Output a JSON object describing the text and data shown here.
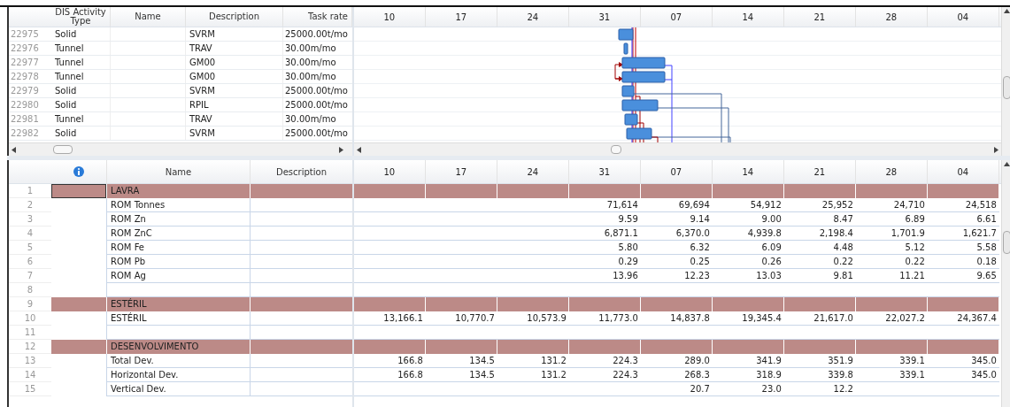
{
  "top_grid": {
    "columns": [
      "DIS Activity Type",
      "Name",
      "Description",
      "Task rate"
    ],
    "rows": [
      {
        "id": "22975",
        "type": "Solid",
        "description": "SVRM",
        "task_rate": "25000.00t/mo"
      },
      {
        "id": "22976",
        "type": "Tunnel",
        "description": "TRAV",
        "task_rate": "30.00m/mo"
      },
      {
        "id": "22977",
        "type": "Tunnel",
        "description": "GM00",
        "task_rate": "30.00m/mo"
      },
      {
        "id": "22978",
        "type": "Tunnel",
        "description": "GM00",
        "task_rate": "30.00m/mo"
      },
      {
        "id": "22979",
        "type": "Solid",
        "description": "SVRM",
        "task_rate": "25000.00t/mo"
      },
      {
        "id": "22980",
        "type": "Solid",
        "description": "RPIL",
        "task_rate": "25000.00t/mo"
      },
      {
        "id": "22981",
        "type": "Tunnel",
        "description": "TRAV",
        "task_rate": "30.00m/mo"
      },
      {
        "id": "22982",
        "type": "Solid",
        "description": "SVRM",
        "task_rate": "25000.00t/mo"
      }
    ],
    "timeline": [
      "10",
      "17",
      "24",
      "31",
      "07",
      "14",
      "21",
      "28",
      "04"
    ]
  },
  "bottom_grid": {
    "columns": [
      "Name",
      "Description"
    ],
    "timeline": [
      "10",
      "17",
      "24",
      "31",
      "07",
      "14",
      "21",
      "28",
      "04"
    ],
    "rows": [
      {
        "number": "1",
        "kind": "group",
        "name": "LAVRA",
        "selected": true
      },
      {
        "number": "2",
        "kind": "item",
        "name": "ROM Tonnes",
        "values": {
          "c3": "71,614",
          "c4": "69,694",
          "c5": "54,912",
          "c6": "25,952",
          "c7": "24,710",
          "c8": "24,518"
        }
      },
      {
        "number": "3",
        "kind": "item",
        "name": "ROM Zn",
        "values": {
          "c3": "9.59",
          "c4": "9.14",
          "c5": "9.00",
          "c6": "8.47",
          "c7": "6.89",
          "c8": "6.61"
        }
      },
      {
        "number": "4",
        "kind": "item",
        "name": "ROM ZnC",
        "values": {
          "c3": "6,871.1",
          "c4": "6,370.0",
          "c5": "4,939.8",
          "c6": "2,198.4",
          "c7": "1,701.9",
          "c8": "1,621.7"
        }
      },
      {
        "number": "5",
        "kind": "item",
        "name": "ROM Fe",
        "values": {
          "c3": "5.80",
          "c4": "6.32",
          "c5": "6.09",
          "c6": "4.48",
          "c7": "5.12",
          "c8": "5.58"
        }
      },
      {
        "number": "6",
        "kind": "item",
        "name": "ROM Pb",
        "values": {
          "c3": "0.29",
          "c4": "0.25",
          "c5": "0.26",
          "c6": "0.22",
          "c7": "0.22",
          "c8": "0.18"
        }
      },
      {
        "number": "7",
        "kind": "item",
        "name": "ROM Ag",
        "values": {
          "c3": "13.96",
          "c4": "12.23",
          "c5": "13.03",
          "c6": "9.81",
          "c7": "11.21",
          "c8": "9.65"
        }
      },
      {
        "number": "8",
        "kind": "blank"
      },
      {
        "number": "9",
        "kind": "group",
        "name": "ESTÉRIL",
        "selected": false
      },
      {
        "number": "10",
        "kind": "item",
        "name": "ESTÉRIL",
        "values": {
          "c0": "13,166.1",
          "c1": "10,770.7",
          "c2": "10,573.9",
          "c3": "11,773.0",
          "c4": "14,837.8",
          "c5": "19,345.4",
          "c6": "21,617.0",
          "c7": "22,027.2",
          "c8": "24,367.4"
        }
      },
      {
        "number": "11",
        "kind": "blank"
      },
      {
        "number": "12",
        "kind": "group",
        "name": "DESENVOLVIMENTO",
        "selected": false
      },
      {
        "number": "13",
        "kind": "item",
        "name": "Total Dev.",
        "values": {
          "c0": "166.8",
          "c1": "134.5",
          "c2": "131.2",
          "c3": "224.3",
          "c4": "289.0",
          "c5": "341.9",
          "c6": "351.9",
          "c7": "339.1",
          "c8": "345.0"
        }
      },
      {
        "number": "14",
        "kind": "item",
        "name": "Horizontal Dev.",
        "values": {
          "c0": "166.8",
          "c1": "134.5",
          "c2": "131.2",
          "c3": "224.3",
          "c4": "268.3",
          "c5": "318.9",
          "c6": "339.8",
          "c7": "339.1",
          "c8": "345.0"
        }
      },
      {
        "number": "15",
        "kind": "item",
        "name": "Vertical Dev.",
        "values": {
          "c4": "20.7",
          "c5": "23.0",
          "c6": "12.2"
        }
      }
    ]
  }
}
